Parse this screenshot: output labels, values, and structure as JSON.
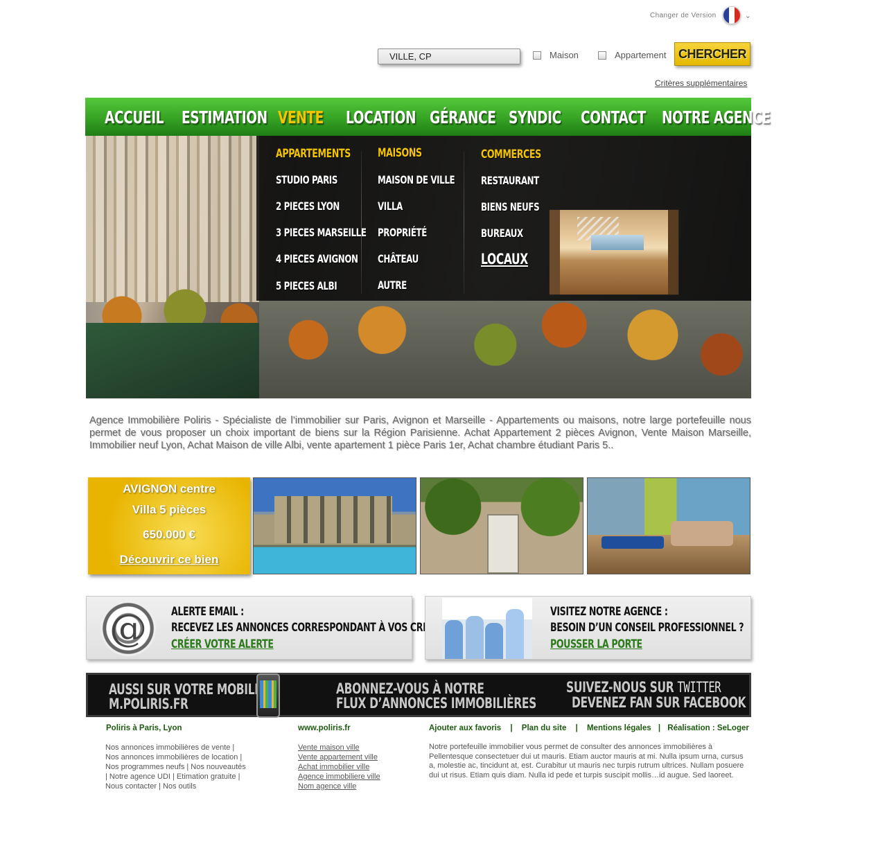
{
  "header": {
    "version_label": "Changer de Version",
    "flag_icon": "france-flag-icon",
    "flag_colors": [
      "#2b3e9b",
      "#ffffff",
      "#d52b1e"
    ]
  },
  "search": {
    "location_value": "VILLE, CP",
    "option_house": "Maison",
    "option_apartment": "Appartement",
    "submit_label": "CHERCHER",
    "more_criteria": "Critères supplémentaires"
  },
  "nav": {
    "items": [
      "ACCUEIL",
      "ESTIMATION",
      "VENTE",
      "LOCATION",
      "GÉRANCE",
      "SYNDIC",
      "CONTACT",
      "NOTRE AGENCE"
    ],
    "active": "VENTE",
    "accent_color": "#3aa826",
    "active_color": "#f5c400"
  },
  "megamenu": {
    "columns": [
      {
        "heading": "APPARTEMENTS",
        "links": [
          "STUDIO PARIS",
          "2 PIECES LYON",
          "3 PIECES MARSEILLE",
          "4 PIECES AVIGNON",
          "5 PIECES ALBI"
        ]
      },
      {
        "heading": "MAISONS",
        "links": [
          "MAISON DE VILLE",
          "VILLA",
          "PROPRIÉTÉ",
          "CHÂTEAU",
          "AUTRE"
        ]
      },
      {
        "heading": "COMMERCES",
        "links": [
          "RESTAURANT",
          "BIENS NEUFS",
          "BUREAUX",
          "LOCAUX"
        ]
      }
    ]
  },
  "intro": {
    "text": "Agence Immobilière Poliris - Spécialiste de l’immobilier sur Paris, Avignon et Marseille - Appartements ou maisons, notre large portefeuille nous permet de vous proposer un choix important de biens sur la Région Parisienne. Achat Appartement 2 pièces Avignon, Vente Maison Marseille, Immobilier neuf Lyon, Achat Maison de ville Albi, vente apartement 1 pièce Paris 1er, Achat chambre étudiant Paris 5.."
  },
  "featured": {
    "location": "AVIGNON centre",
    "type": "Villa 5 pièces",
    "price": "650.000 €",
    "cta": "Découvrir ce bien"
  },
  "promos": {
    "alert": {
      "line1": "ALERTE EMAIL :",
      "line2": "RECEVEZ LES ANNONCES CORRESPONDANT À VOS CRITÈRES",
      "link": "CRÉER VOTRE ALERTE"
    },
    "agency": {
      "line1": "VISITEZ NOTRE AGENCE :",
      "line2": "BESOIN D’UN CONSEIL PROFESSIONNEL ?",
      "link": "POUSSER LA PORTE"
    }
  },
  "banner": {
    "mobile_line1": "AUSSI SUR VOTRE MOBILE",
    "mobile_line2": "M.POLIRIS.FR",
    "feed_line1": "ABONNEZ-VOUS À NOTRE",
    "feed_line2": "FLUX D’ANNONCES IMMOBILIÈRES",
    "social_line1a": "SUIVEZ-NOUS SUR",
    "social_line1b": "TWITTER",
    "social_line2": "DEVENEZ FAN SUR FACEBOOK"
  },
  "footer": {
    "col1_heading": "Poliris à Paris, Lyon",
    "col1_lines": [
      "Nos annonces immobilières de vente |",
      "Nos annonces immobilières de location |",
      "Nos programmes neufs | Nos nouveautés",
      "| Notre agence UDI | Etimation gratuite |",
      "Nous contacter | Nos outils"
    ],
    "col2_heading": "www.poliris.fr",
    "col2_links": [
      "Vente maison ville",
      "Vente appartement ville",
      "Achat immobilier ville",
      "Agence immobiliere ville",
      "Nom agence ville"
    ],
    "col3_links": [
      "Ajouter aux favoris",
      "Plan du site",
      "Mentions légales",
      "Réalisation : SeLoger"
    ],
    "col3_text": "Notre portefeuille immobilier vous permet de consulter des annonces immobilières à Pellentesque consectetuer dui ut mauris. Etiam auctor mauris at mi. Nulla ipsum urna, cursus a, molestie ac, tincidunt at, est. Curabitur ut mauris nec turpis rutrum ultrices. Nullam posuere dui ut risus. Etiam quis diam. Nulla id pede et turpis suscipit mollis…id augue. Sed laoreet."
  }
}
